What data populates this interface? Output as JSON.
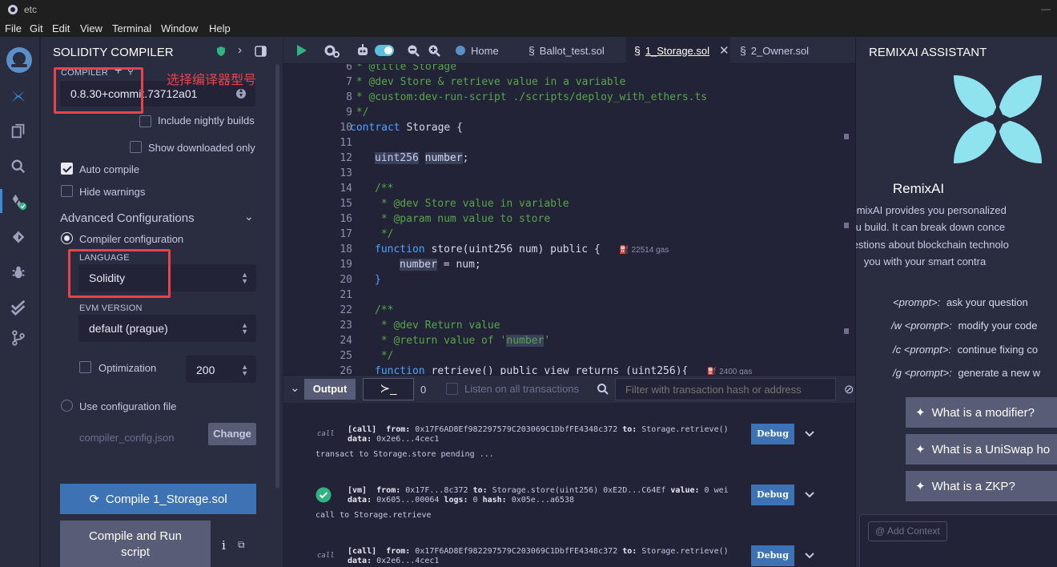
{
  "window": {
    "title": "etc"
  },
  "menu": [
    "File",
    "Git",
    "Edit",
    "View",
    "Terminal",
    "Window",
    "Help"
  ],
  "rail_icons": [
    "remix-logo-icon",
    "remixai-icon",
    "file-explorer-icon",
    "search-icon",
    "solidity-compiler-icon",
    "deploy-icon",
    "debugger-icon",
    "test-icon",
    "git-icon"
  ],
  "compiler": {
    "title": "SOLIDITY COMPILER",
    "compiler_caption": "COMPILER",
    "compiler_value": "0.8.30+commit.73712a01",
    "include_nightly": "Include nightly builds",
    "show_downloaded": "Show downloaded only",
    "auto_compile": "Auto compile",
    "hide_warnings": "Hide warnings",
    "advanced": "Advanced Configurations",
    "compiler_configuration": "Compiler configuration",
    "language_caption": "LANGUAGE",
    "language_value": "Solidity",
    "evm_caption": "EVM VERSION",
    "evm_value": "default (prague)",
    "optimization": "Optimization",
    "optimization_runs": "200",
    "use_config_file": "Use configuration file",
    "config_file": "compiler_config.json",
    "change": "Change",
    "compile_button": "Compile 1_Storage.sol",
    "compile_run_line1": "Compile and Run",
    "compile_run_line2": "script"
  },
  "annotation": "选择编译器型号",
  "tabs": {
    "home": "Home",
    "ballot": "Ballot_test.sol",
    "storage": "1_Storage.sol",
    "owner": "2_Owner.sol"
  },
  "code": {
    "line_numbers": [
      "6",
      "7",
      "8",
      "9",
      "10",
      "11",
      "12",
      "13",
      "14",
      "15",
      "16",
      "17",
      "18",
      "19",
      "20",
      "21",
      "22",
      "23",
      "24",
      "25",
      "26"
    ],
    "l6": " * @title Storage",
    "l7": " * @dev Store & retrieve value in a variable",
    "l8": " * @custom:dev-run-script ./scripts/deploy_with_ethers.ts",
    "l9": " */",
    "l10_kw": "contract",
    "l10_rest": " Storage {",
    "l12_type": "uint256",
    "l12_var": "number",
    "l12_end": ";",
    "l14": "/**",
    "l15": " * @dev Store value in variable",
    "l16": " * @param num value to store",
    "l17": " */",
    "l18_kw": "function",
    "l18_rest": " store(uint256 num) public {",
    "l18_gas": "22514 gas",
    "l19_var": "number",
    "l19_rest": " = num;",
    "l20": "}",
    "l22": "/**",
    "l23": " * @dev Return value",
    "l24_pre": " * @return value of '",
    "l24_var": "number",
    "l24_post": "'",
    "l25": " */",
    "l26_kw": "function",
    "l26_rest": " retrieve() public view returns (uint256){",
    "l26_gas": "2400 gas"
  },
  "terminal": {
    "output_label": "Output",
    "count": "0",
    "listen_label": "Listen on all transactions",
    "filter_placeholder": "Filter with transaction hash or address",
    "call1_tag": "call",
    "call1_line1_a": "[call]",
    "call1_line1_b": "from:",
    "call1_line1_c": " 0x17F6AD8Ef982297579C203069C1DbfFE4348c372 ",
    "call1_line1_d": "to:",
    "call1_line1_e": " Storage.retrieve()",
    "call1_line2_a": "data:",
    "call1_line2_b": " 0x2e6...4cec1",
    "pending": "transact to Storage.store pending ...",
    "vm_line1_a": "[vm]",
    "vm_line1_b": "from:",
    "vm_line1_c": " 0x17F...8c372 ",
    "vm_line1_d": "to:",
    "vm_line1_e": " Storage.store(uint256) 0xE2D...C64Ef ",
    "vm_line1_f": "value:",
    "vm_line1_g": " 0 wei",
    "vm_line2_a": "data:",
    "vm_line2_b": " 0x605...00064 ",
    "vm_line2_c": "logs:",
    "vm_line2_d": " 0 ",
    "vm_line2_e": "hash:",
    "vm_line2_f": " 0x05e...a6538",
    "call_retrieve": "call to Storage.retrieve",
    "debug": "Debug"
  },
  "ai": {
    "title": "REMIXAI ASSISTANT",
    "name": "RemixAI",
    "desc1": "RemixAI provides you personalized",
    "desc2": "you build. It can break down conce",
    "desc3": "questions about blockchain technolo",
    "desc4": "you with your smart contra",
    "p1_cmd": "<prompt>:",
    "p1_text": "ask your question",
    "p2_cmd": "/w <prompt>:",
    "p2_text": "modify your code",
    "p3_cmd": "/c <prompt>:",
    "p3_text": "continue fixing co",
    "p4_cmd": "/g <prompt>:",
    "p4_text": "generate a new w",
    "q1": "What is a modifier?",
    "q2": "What is a UniSwap ho",
    "q3": "What is a ZKP?",
    "add_context": "@ Add Context"
  },
  "colors": {
    "accent": "#3d73b5",
    "annotation": "#e8434b",
    "success": "#2fb380",
    "ai_logo": "#8fe3ee"
  }
}
